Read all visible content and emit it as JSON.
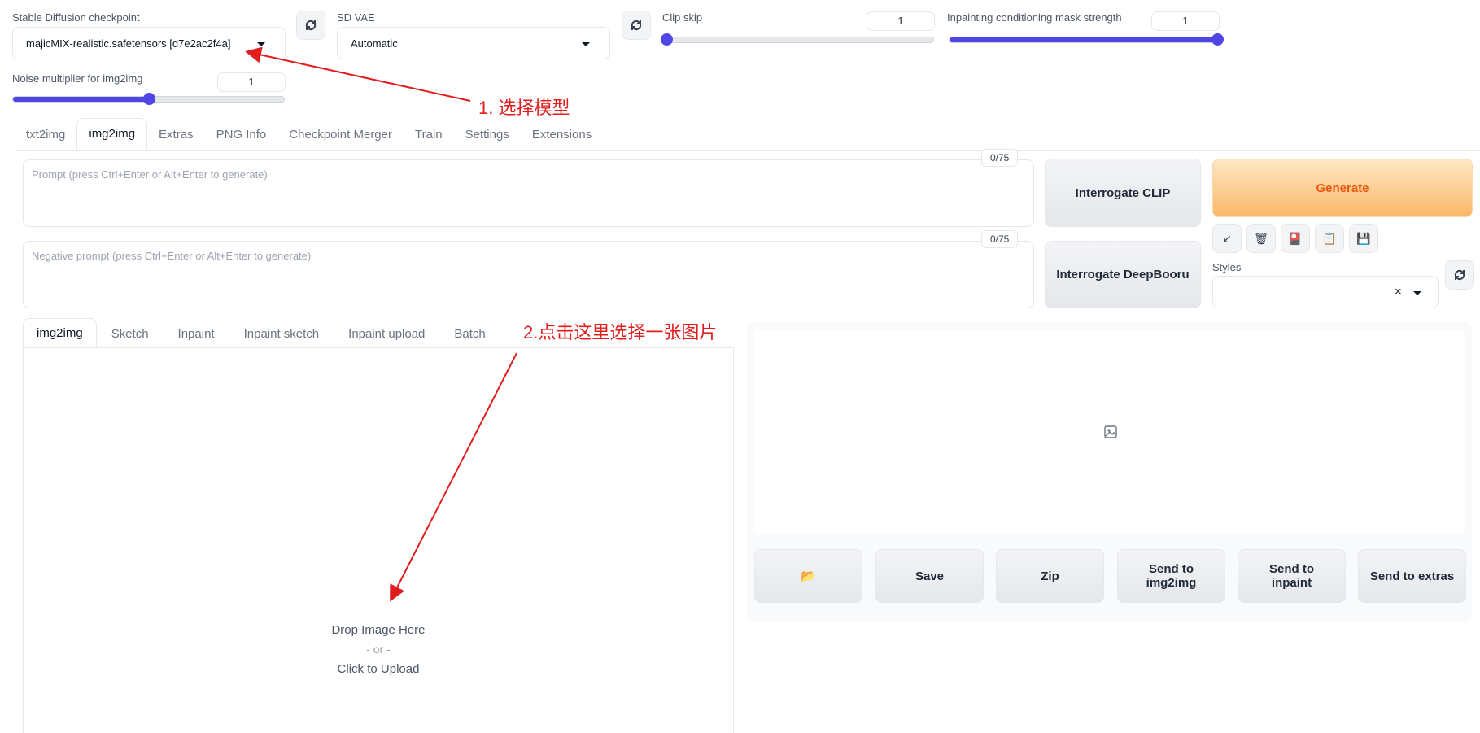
{
  "top": {
    "checkpoint": {
      "label": "Stable Diffusion checkpoint",
      "value": "majicMIX-realistic.safetensors [d7e2ac2f4a]"
    },
    "vae": {
      "label": "SD VAE",
      "value": "Automatic"
    },
    "clip_skip": {
      "label": "Clip skip",
      "value": "1",
      "fraction": 0.0
    },
    "inpaint_mask": {
      "label": "Inpainting conditioning mask strength",
      "value": "1",
      "fraction": 1.0
    },
    "noise_mult": {
      "label": "Noise multiplier for img2img",
      "value": "1",
      "fraction": 0.5
    },
    "refresh_icon": "refresh-icon"
  },
  "main_tabs": [
    "txt2img",
    "img2img",
    "Extras",
    "PNG Info",
    "Checkpoint Merger",
    "Train",
    "Settings",
    "Extensions"
  ],
  "active_main_tab": "img2img",
  "prompt": {
    "placeholder": "Prompt (press Ctrl+Enter or Alt+Enter to generate)",
    "counter": "0/75"
  },
  "negative_prompt": {
    "placeholder": "Negative prompt (press Ctrl+Enter or Alt+Enter to generate)",
    "counter": "0/75"
  },
  "buttons": {
    "interrogate_clip": "Interrogate CLIP",
    "interrogate_deepbooru": "Interrogate DeepBooru",
    "generate": "Generate"
  },
  "tool_icons": [
    "arrow-icon",
    "trash-icon",
    "card-icon",
    "clipboard-icon",
    "save-icon"
  ],
  "styles": {
    "label": "Styles",
    "clear": "×"
  },
  "sub_tabs": [
    "img2img",
    "Sketch",
    "Inpaint",
    "Inpaint sketch",
    "Inpaint upload",
    "Batch"
  ],
  "active_sub_tab": "img2img",
  "upload": {
    "line1": "Drop Image Here",
    "line2": "- or -",
    "line3": "Click to Upload"
  },
  "output_buttons": [
    "📂",
    "Save",
    "Zip",
    "Send to img2img",
    "Send to inpaint",
    "Send to extras"
  ],
  "annotations": {
    "step1": "1. 选择模型",
    "step2": "2.点击这里选择一张图片"
  },
  "colors": {
    "accent": "#4f46e5",
    "annotation": "#e11d1d",
    "generate_text": "#ea580c"
  }
}
